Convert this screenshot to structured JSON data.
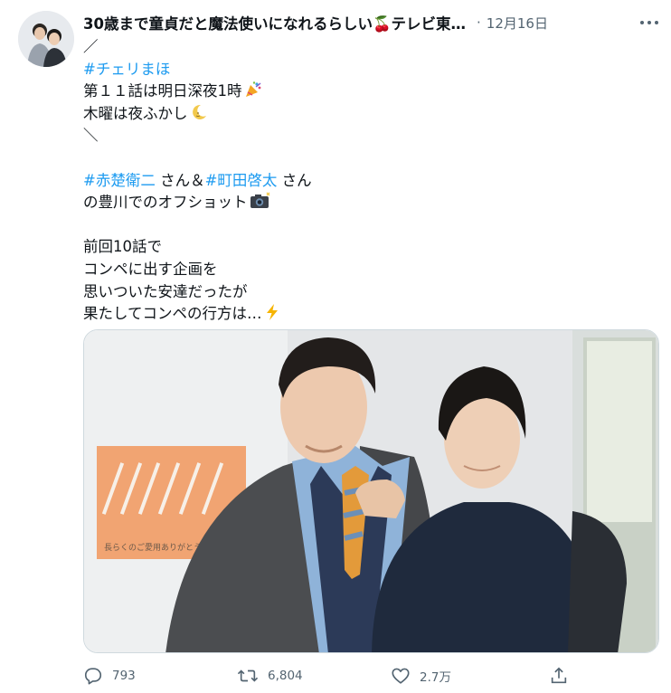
{
  "tweet": {
    "author_name": "30歳まで童貞だと魔法使いになれるらしい🍒テレビ東…",
    "separator": "·",
    "date": "12月16日",
    "lines": [
      [
        {
          "t": "／"
        }
      ],
      [
        {
          "t": "#チェリまほ",
          "tag": true
        }
      ],
      [
        {
          "t": "第１１話は明日深夜1時"
        },
        {
          "e": "party-popper-emoji"
        }
      ],
      [
        {
          "t": "木曜は夜ふかし"
        },
        {
          "e": "crescent-moon-emoji"
        }
      ],
      [
        {
          "t": "＼"
        }
      ],
      [],
      [
        {
          "t": "#赤楚衛二",
          "tag": true
        },
        {
          "t": " さん＆"
        },
        {
          "t": "#町田啓太",
          "tag": true
        },
        {
          "t": " さん"
        }
      ],
      [
        {
          "t": "の豊川でのオフショット"
        },
        {
          "e": "camera-flash-emoji"
        }
      ],
      [],
      [
        {
          "t": "前回10話で"
        }
      ],
      [
        {
          "t": "コンペに出す企画を"
        }
      ],
      [
        {
          "t": "思いついた安達だったが"
        }
      ],
      [
        {
          "t": "果たしてコンペの行方は…"
        },
        {
          "e": "lightning-emoji"
        }
      ]
    ],
    "photo": {
      "poster_caption": "長らくのご愛用ありがとう"
    },
    "actions": {
      "reply_count": "793",
      "retweet_count": "6,804",
      "like_count": "2.7万"
    },
    "colors": {
      "link": "#1d9bf0",
      "muted": "#536471",
      "border": "#cfd9de"
    }
  }
}
